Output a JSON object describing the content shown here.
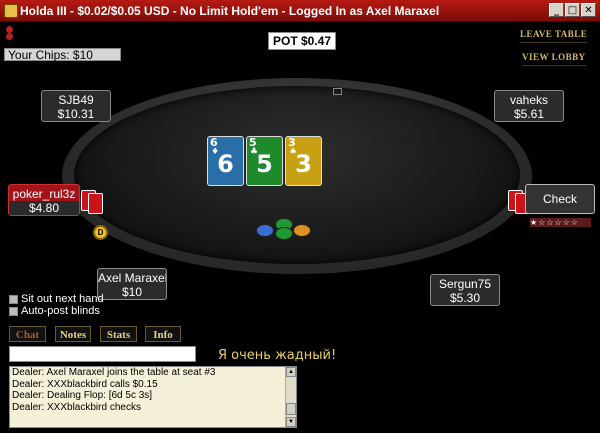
{
  "window": {
    "title": "Holda III - $0.02/$0.05 USD - No Limit Hold'em - Logged In as Axel Maraxel",
    "minimize": "_",
    "maximize": "□",
    "close": "✕"
  },
  "header": {
    "your_chips": "Your Chips: $10",
    "pot": "POT $0.47",
    "leave_table": "LEAVE TABLE",
    "view_lobby": "VIEW LOBBY"
  },
  "seats": [
    {
      "name": "SJB49",
      "amount": "$10.31"
    },
    {
      "name": "vaheks",
      "amount": "$5.61"
    },
    {
      "name": "poker_rul3z",
      "amount": "$4.80"
    },
    {
      "name": "Axel Maraxel",
      "amount": "$10"
    },
    {
      "name": "Sergun75",
      "amount": "$5.30"
    }
  ],
  "board": {
    "cards": [
      {
        "rank": "6",
        "suit": "♦",
        "color": "#2a6ea8"
      },
      {
        "rank": "5",
        "suit": "♣",
        "color": "#1f8a2c"
      },
      {
        "rank": "3",
        "suit": "♠",
        "color": "#c8a014"
      }
    ]
  },
  "dealer_button": "D",
  "actions": {
    "check": "Check"
  },
  "options": {
    "sit_out": "Sit out next hand",
    "auto_post": "Auto-post blinds"
  },
  "tabs": {
    "chat": "Chat",
    "notes": "Notes",
    "stats": "Stats",
    "info": "Info"
  },
  "chat": {
    "input_value": "",
    "message": "Я очень жадный!",
    "log": [
      "Dealer: Axel Maraxel joins the table at seat #3",
      "Dealer: XXXblackbird calls $0.15",
      "Dealer: Dealing Flop: [6d 5c 3s]",
      "Dealer: XXXblackbird checks"
    ]
  },
  "colors": {
    "titlebar": "#b51a12",
    "highlight_seat": "#a3141a",
    "link_gold": "#d9b864"
  }
}
